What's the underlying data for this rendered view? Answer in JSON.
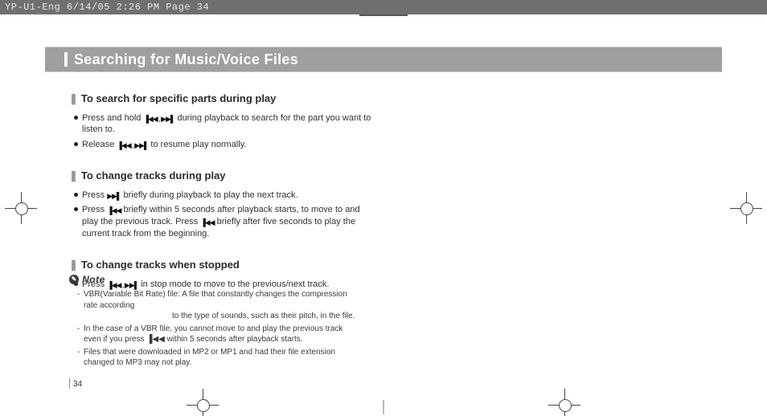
{
  "meta": {
    "header": "YP-U1-Eng  6/14/05 2:26 PM  Page 34"
  },
  "title": "Searching for Music/Voice Files",
  "sections": [
    {
      "heading": "To search for specific parts during play",
      "items": [
        {
          "pre": "Press and hold ",
          "icon": "prev-next-icon",
          "post": " during playback to search for the part you want to listen to."
        },
        {
          "pre": "Release ",
          "icon": "prev-next-icon",
          "post": " to resume play normally."
        }
      ]
    },
    {
      "heading": "To change tracks during play",
      "items": [
        {
          "pre": "Press ",
          "icon": "next-icon",
          "post": " briefly during playback to play the next track."
        },
        {
          "pre": "Press ",
          "icon": "prev-icon",
          "post": " briefly within 5 seconds after playback starts, to move to and play the previous track. Press ",
          "icon2": "prev-icon",
          "post2": " briefly after five seconds to play the current track from the beginning."
        }
      ]
    },
    {
      "heading": "To change tracks when stopped",
      "items": [
        {
          "pre": "Press ",
          "icon": "prev-next-icon",
          "post": " in stop mode to move to the previous/next track."
        }
      ]
    }
  ],
  "note": {
    "label": "Note",
    "items": [
      "VBR(Variable Bit Rate) file: A file that constantly changes the compression rate according to the type of sounds, such as their pitch, in the file.",
      "In the case of a VBR file, you cannot move to and play the previous track even if you press  ▐◀◀  within 5 seconds after playback starts.",
      "Files that were downloaded in MP2 or MP1 and had their file extension changed to MP3 may not play."
    ]
  },
  "page_number": "34",
  "icons": {
    "prev-icon": "▐◀◀",
    "next-icon": "▶▶▌",
    "prev-next-icon": "▐◀◀ , ▶▶▌"
  }
}
